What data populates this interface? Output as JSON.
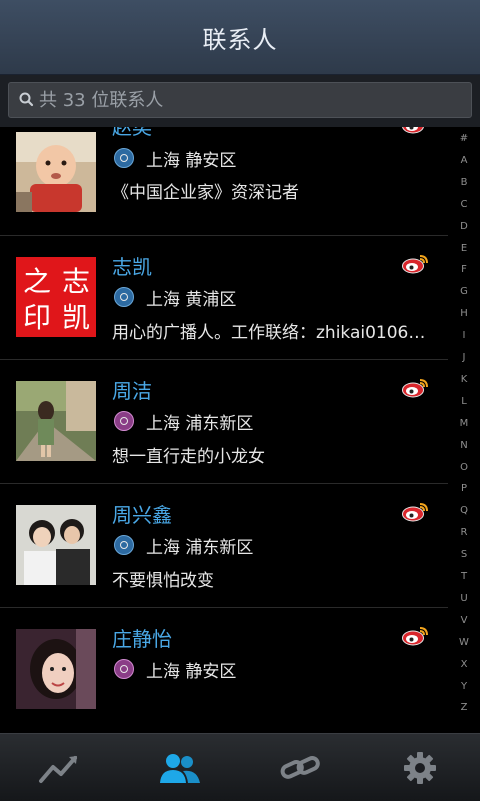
{
  "header": {
    "title": "联系人"
  },
  "search": {
    "placeholder": "共 33 位联系人"
  },
  "contacts": [
    {
      "name": "赵奕",
      "gender": "male",
      "location": "上海 静安区",
      "bio": "《中国企业家》资深记者"
    },
    {
      "name": "志凯",
      "gender": "male",
      "location": "上海 黄浦区",
      "bio": "用心的广播人。工作联络：zhikai0106…"
    },
    {
      "name": "周洁",
      "gender": "female",
      "location": "上海 浦东新区",
      "bio": "想一直行走的小龙女"
    },
    {
      "name": "周兴鑫",
      "gender": "male",
      "location": "上海 浦东新区",
      "bio": "不要惧怕改变"
    },
    {
      "name": "庄静怡",
      "gender": "female",
      "location": "上海 静安区",
      "bio": ""
    }
  ],
  "avatar_text": {
    "line1a": "志",
    "line1b": "之",
    "line2a": "凯",
    "line2b": "印"
  },
  "index_letters": [
    "#",
    "A",
    "B",
    "C",
    "D",
    "E",
    "F",
    "G",
    "H",
    "I",
    "J",
    "K",
    "L",
    "M",
    "N",
    "O",
    "P",
    "Q",
    "R",
    "S",
    "T",
    "U",
    "V",
    "W",
    "X",
    "Y",
    "Z"
  ],
  "tabs": [
    {
      "name": "trends",
      "icon": "trend-chart-icon",
      "active": false
    },
    {
      "name": "contacts",
      "icon": "people-icon",
      "active": true
    },
    {
      "name": "links",
      "icon": "link-icon",
      "active": false
    },
    {
      "name": "settings",
      "icon": "gear-icon",
      "active": false
    }
  ],
  "colors": {
    "accent": "#1a9de0",
    "name": "#4aa8e6",
    "header": "#3e4e63"
  }
}
